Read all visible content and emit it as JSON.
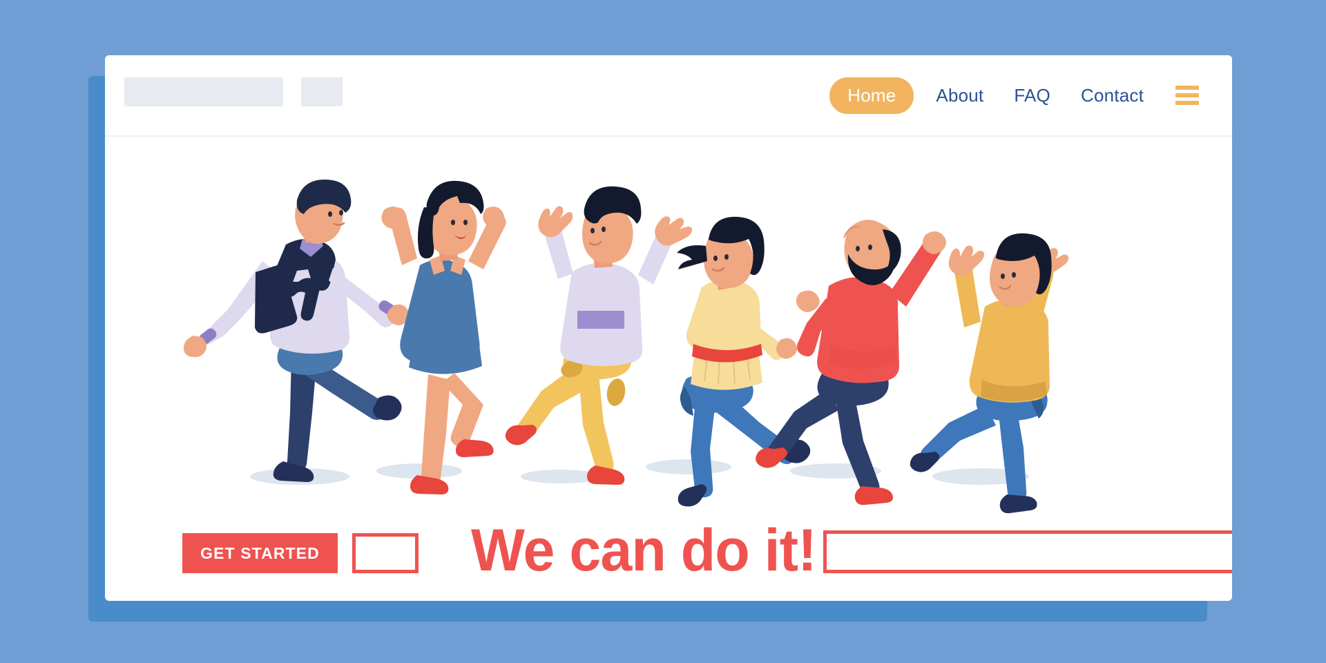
{
  "page": {
    "background_color": "#6e9ed3",
    "card_background": "#ffffff",
    "shadow_color": "#4a8cc9"
  },
  "chrome": {
    "logo_placeholder_label": "",
    "logo_placeholder_small_label": ""
  },
  "nav": {
    "items": [
      {
        "label": "Home",
        "active": true
      },
      {
        "label": "About",
        "active": false
      },
      {
        "label": "FAQ",
        "active": false
      },
      {
        "label": "Contact",
        "active": false
      }
    ],
    "active_color": "#f2b45e",
    "link_color": "#2b5191",
    "menu_icon": "hamburger-icon"
  },
  "hero": {
    "illustration_name": "jumping-celebrating-people-illustration",
    "figures": [
      {
        "id": "figure-man-with-sweater",
        "description": "Man with dark navy hair wearing a lavender shirt with a navy sweater tied over shoulders, blue jeans and navy shoes, one knee raised",
        "hair": "#1f2a4a",
        "top": "#ded9ee",
        "accent": "#1f2a4a",
        "bottom": "#345b84",
        "shoes": "#1f2a4a"
      },
      {
        "id": "figure-woman-blue-dress",
        "description": "Woman with black ponytail in a blue sleeveless dress and red sneakers, both arms raised",
        "hair": "#141a2e",
        "top": "#4a79ad",
        "bottom": "#4a79ad",
        "shoes": "#e8453c"
      },
      {
        "id": "figure-man-yellow-pants",
        "description": "Man with black hair in a lavender sweatshirt with purple stripe, mustard pants and red sneakers, arms up",
        "hair": "#141a2e",
        "top": "#ded9ee",
        "accent": "#9b8fd0",
        "bottom": "#f2c45e",
        "shoes": "#e8453c"
      },
      {
        "id": "figure-woman-yellow-top",
        "description": "Woman with black bob in a yellow top with red belt, blue jeans and navy shoes, one fist raised",
        "hair": "#141a2e",
        "top": "#f7dc9a",
        "accent": "#e8453c",
        "bottom": "#4a79ad",
        "shoes": "#1f2a4a"
      },
      {
        "id": "figure-bald-bearded-man",
        "description": "Bald bearded man in a coral red sweater, navy pants and red sneakers, fist punched up",
        "hair": "#141a2e",
        "top": "#ef5350",
        "bottom": "#2d3f6b",
        "shoes": "#e8453c"
      },
      {
        "id": "figure-woman-mustard-sweater",
        "description": "Woman with black bob in a mustard sweater and blue jeans with navy shoes, both arms overhead",
        "hair": "#141a2e",
        "top": "#edb855",
        "bottom": "#3f78ba",
        "shoes": "#1f2a4a"
      }
    ]
  },
  "cta": {
    "button_label": "GET STARTED",
    "button_color": "#ef5350",
    "button_text_color": "#ffffff",
    "small_box_label": "",
    "headline": "We can do it!",
    "headline_color": "#ef5350",
    "long_bar_label": "",
    "outline_color": "#ef5350"
  }
}
